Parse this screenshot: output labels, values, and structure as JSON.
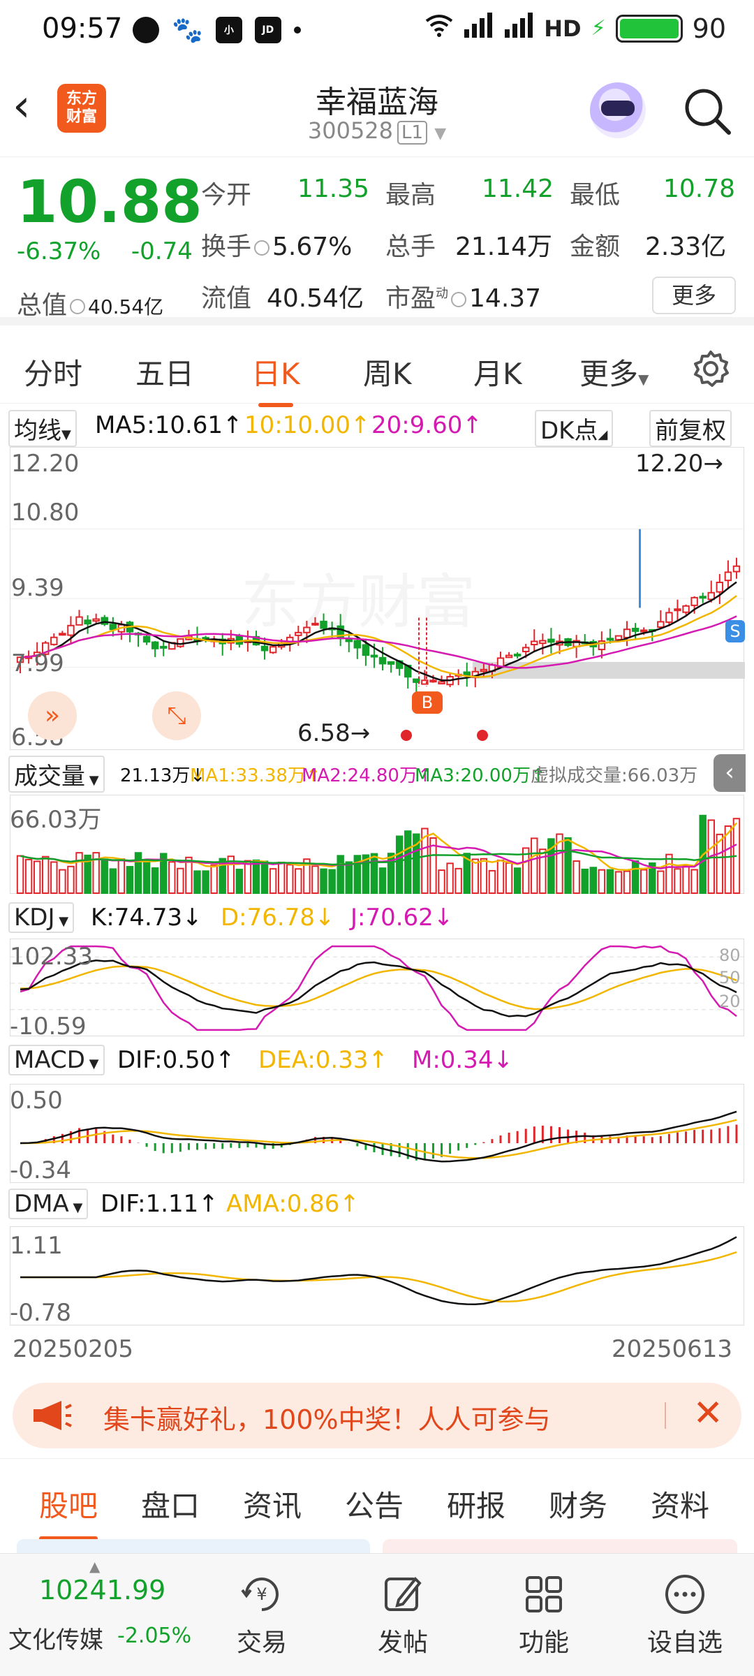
{
  "status_bar": {
    "time": "09:57",
    "network": "HD",
    "battery": "90"
  },
  "header": {
    "back": "‹",
    "logo_line1": "东方",
    "logo_line2": "财富",
    "title": "幸福蓝海",
    "code": "300528",
    "level": "L1"
  },
  "quote": {
    "price": "10.88",
    "change_pct": "-6.37%",
    "change": "-0.74",
    "open_label": "今开",
    "open": "11.35",
    "high_label": "最高",
    "high": "11.42",
    "low_label": "最低",
    "low": "10.78",
    "turnover_label": "换手",
    "turnover": "5.67%",
    "volume_label": "总手",
    "volume": "21.14万",
    "amount_label": "金额",
    "amount": "2.33亿",
    "mktcap_label": "总值",
    "mktcap": "40.54亿",
    "float_label": "流值",
    "float": "40.54亿",
    "pe_label": "市盈",
    "pe_sup": "动",
    "pe": "14.37",
    "more": "更多"
  },
  "ktabs": [
    "分时",
    "五日",
    "日K",
    "周K",
    "月K",
    "更多"
  ],
  "kline": {
    "ma_selector": "均线",
    "ma5": "MA5:10.61↑",
    "ma10": "10:10.00↑",
    "ma20": "20:9.60↑",
    "dk": "DK点",
    "adjust": "前复权",
    "y_labels": [
      "12.20",
      "10.80",
      "9.39",
      "7.99",
      "6.58"
    ],
    "max_mark": "12.20→",
    "min_mark": "6.58→",
    "watermark": "东方财富",
    "b_mark": "B",
    "s_mark": "S"
  },
  "volume": {
    "selector": "成交量",
    "vol": "21.13万↓",
    "ma1": "MA1:33.38万↑",
    "ma2": "MA2:24.80万↑",
    "ma3": "MA3:20.00万↑",
    "virtual": "虚拟成交量:66.03万",
    "ymax": "66.03万"
  },
  "kdj": {
    "selector": "KDJ",
    "k": "K:74.73↓",
    "d": "D:76.78↓",
    "j": "J:70.62↓",
    "ymax": "102.33",
    "ymin": "-10.59",
    "lvl80": "80",
    "lvl50": "50",
    "lvl20": "20"
  },
  "macd": {
    "selector": "MACD",
    "dif": "DIF:0.50↑",
    "dea": "DEA:0.33↑",
    "m": "M:0.34↓",
    "ymax": "0.50",
    "ymin": "-0.34"
  },
  "dma": {
    "selector": "DMA",
    "dif": "DIF:1.11↑",
    "ama": "AMA:0.86↑",
    "ymax": "1.11",
    "ymin": "-0.78"
  },
  "dates": {
    "start": "20250205",
    "end": "20250613"
  },
  "banner": {
    "text": "集卡赢好礼，100%中奖！人人可参与",
    "close": "✕"
  },
  "bottom_tabs": [
    "股吧",
    "盘口",
    "资讯",
    "公告",
    "研报",
    "财务",
    "资料"
  ],
  "index": {
    "value": "10241.99",
    "name": "文化传媒",
    "change": "-2.05%"
  },
  "bottom_nav": [
    "交易",
    "发帖",
    "功能",
    "设自选"
  ],
  "colors": {
    "up": "#e0262b",
    "down": "#12a12a",
    "accent": "#f25a1d",
    "ma5": "#111111",
    "ma10": "#f2b600",
    "ma20": "#d41ab0"
  }
}
